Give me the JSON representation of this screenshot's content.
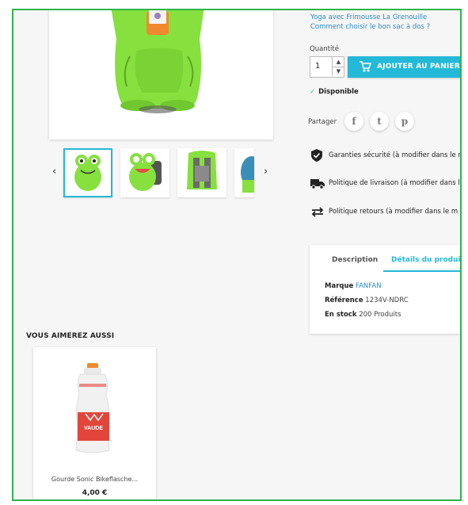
{
  "links": [
    "Yoga avec Frimousse La Grenouille",
    "Comment choisir le bon sac à dos ?"
  ],
  "product": {
    "quantity_label": "Quantité",
    "quantity_value": "1",
    "add_to_cart": "AJOUTER AU PANIER",
    "availability": "Disponible",
    "share_label": "Partager"
  },
  "social": [
    "f",
    "t",
    "p"
  ],
  "reassurance": [
    {
      "icon": "shield-icon",
      "text": "Garanties sécurité (à modifier dans le m"
    },
    {
      "icon": "truck-icon",
      "text": "Politique de livraison (à modifier dans l"
    },
    {
      "icon": "exchange-arrows-icon",
      "text": "Politique retours (à modifier dans le m"
    }
  ],
  "tabs": [
    {
      "label": "Description",
      "active": false
    },
    {
      "label": "Détails du produit",
      "active": true
    }
  ],
  "details": {
    "brand_label": "Marque",
    "brand_value": "FANFAN",
    "reference_label": "Référence",
    "reference_value": "1234V-NDRC",
    "stock_label": "En stock",
    "stock_value": "200 Produits"
  },
  "related": {
    "title": "VOUS AIMEREZ AUSSI",
    "items": [
      {
        "name": "Gourde Sonic Bikeflasche...",
        "price": "4,00 €",
        "brand_on_bottle": "VAUDE"
      }
    ]
  },
  "colors": {
    "accent": "#24b9d7",
    "frame": "#2fb44a",
    "frog_green": "#86e03e",
    "check": "#4cbb6c"
  }
}
